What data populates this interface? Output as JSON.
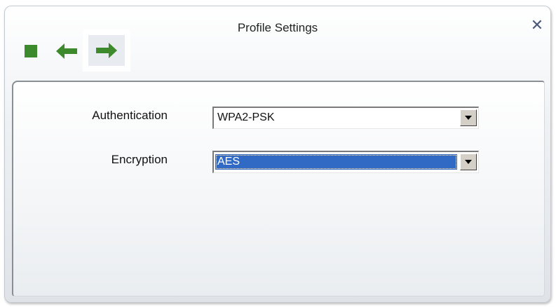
{
  "window": {
    "title": "Profile Settings",
    "close_icon": "close-icon"
  },
  "toolbar": {
    "buttons": [
      {
        "name": "stop",
        "icon": "stop-square-icon",
        "color": "#3d8a2c"
      },
      {
        "name": "back",
        "icon": "arrow-left-icon",
        "color": "#3d8a2c"
      },
      {
        "name": "next",
        "icon": "arrow-right-icon",
        "color": "#3d8a2c",
        "state": "highlighted"
      }
    ]
  },
  "form": {
    "authentication": {
      "label": "Authentication",
      "value": "WPA2-PSK"
    },
    "encryption": {
      "label": "Encryption",
      "value": "AES",
      "state": "focused-selected"
    }
  },
  "colors": {
    "accent_green": "#3d8a2c",
    "selection_blue": "#316ac5"
  }
}
